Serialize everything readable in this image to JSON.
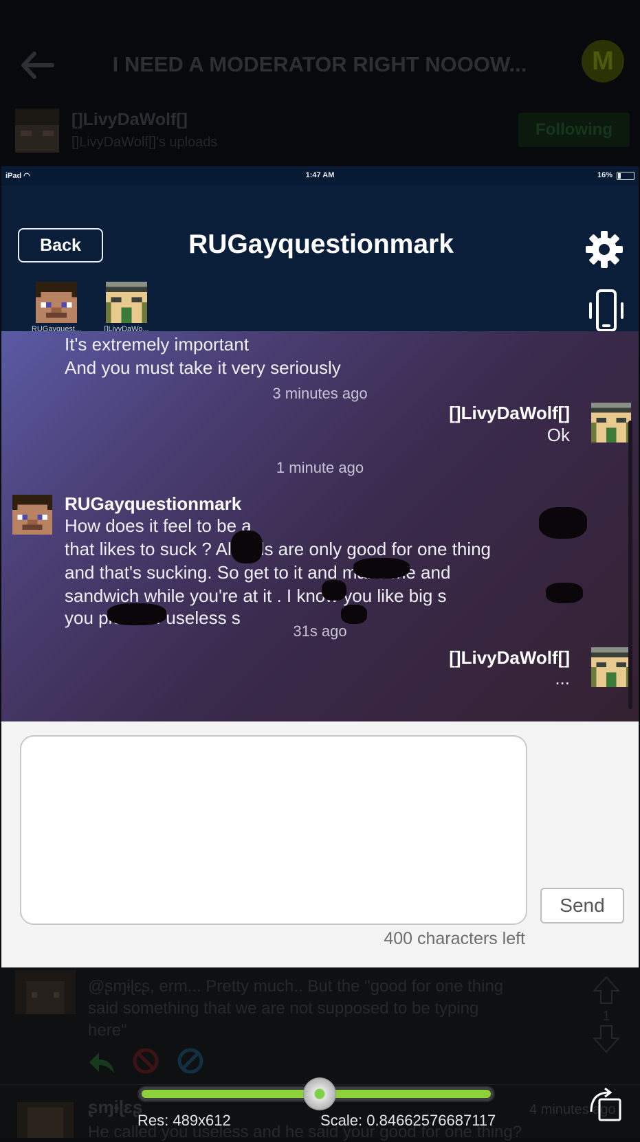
{
  "outer": {
    "title": "I NEED A MODERATOR RIGHT NOOOW...",
    "logo_letter": "M",
    "username": "[]LivyDaWolf[]",
    "uploads_label": "[]LivyDaWolf[]'s uploads",
    "follow_label": "Following"
  },
  "status_bar": {
    "device": "iPad",
    "time": "1:47 AM",
    "battery": "16%"
  },
  "chat": {
    "back_label": "Back",
    "title": "RUGayquestionmark",
    "members": [
      {
        "name": "RUGayquest..."
      },
      {
        "name": "[]LivyDaWo..."
      }
    ],
    "messages": {
      "m1_line1": "It's extremely important",
      "m1_line2": "And you must take it very seriously",
      "ts1": "3 minutes ago",
      "out1_name": "[]LivyDaWolf[]",
      "out1_text": "Ok",
      "ts2": "1 minute ago",
      "in2_name": "RUGayquestionmark",
      "in2_line1": "How does it feel to be a",
      "in2_line2": "that likes to suck      ? All girls are only good for one thing",
      "in2_line3": "and that's sucking. So get to it          and make me and",
      "in2_line4": "sandwich while you're at it       . I know you like big        s",
      "in2_line5": "you          piece of useless s",
      "ts3": "31s ago",
      "out2_name": "[]LivyDaWolf[]",
      "out2_text": "..."
    },
    "send_label": "Send",
    "chars_left": "400 characters left"
  },
  "comment": {
    "text_line1": "@ʂɱɨɭɛʂ, erm... Pretty much.. But the \"good for one thing",
    "text_line2": "said something that we are not supposed to be typing",
    "text_line3": "here\"",
    "vote_count": "1",
    "next_name": "ʂɱɨɭɛʂ",
    "next_time": "4 minutes ago",
    "next_text": "He called you useless and he said your good for one thing?"
  },
  "viewer": {
    "res": "Res: 489x612",
    "scale": "Scale: 0.84662576687117",
    "slider_fraction": 0.48
  },
  "colors": {
    "header_bg": "#0a1e3a",
    "accent_green": "#8bd23a"
  }
}
